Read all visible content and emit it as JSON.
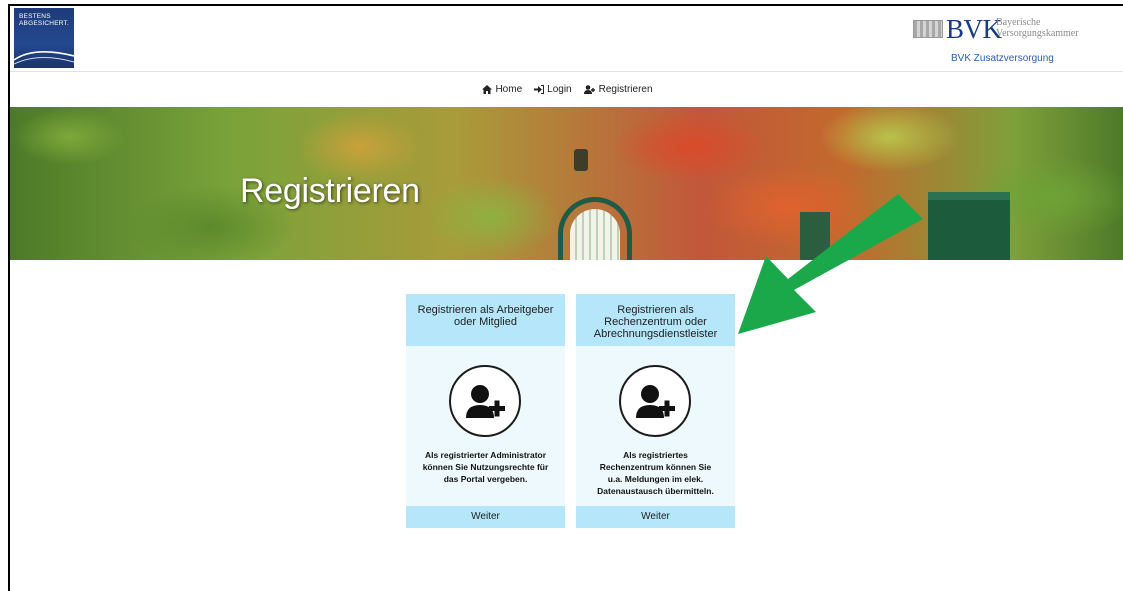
{
  "header": {
    "logo_left_text": "BESTENS ABGESICHERT.",
    "logo_right_title": "BVK",
    "logo_right_sub1": "Bayerische",
    "logo_right_sub2": "Versorgungskammer",
    "logo_right_link": "BVK Zusatzversorgung"
  },
  "nav": {
    "items": [
      {
        "label": "Home",
        "icon": "home-icon"
      },
      {
        "label": "Login",
        "icon": "login-icon"
      },
      {
        "label": "Registrieren",
        "icon": "add-user-icon"
      }
    ]
  },
  "banner": {
    "title": "Registrieren"
  },
  "cards": [
    {
      "title": "Registrieren als Arbeitgeber oder Mitglied",
      "icon": "add-user-icon",
      "description": "Als registrierter Administrator können Sie Nutzungsrechte für das Portal vergeben.",
      "button": "Weiter"
    },
    {
      "title": "Registrieren als Rechenzentrum oder Abrechnungsdienstleister",
      "icon": "add-user-icon",
      "description": "Als registriertes Rechenzentrum können Sie u.a. Meldungen im elek. Datenaustausch übermitteln.",
      "button": "Weiter"
    }
  ],
  "colors": {
    "card_header": "#b5e6fa",
    "card_body": "#eef9fd",
    "annotation_arrow": "#1aa84a",
    "bvk_blue": "#1a3b82"
  }
}
